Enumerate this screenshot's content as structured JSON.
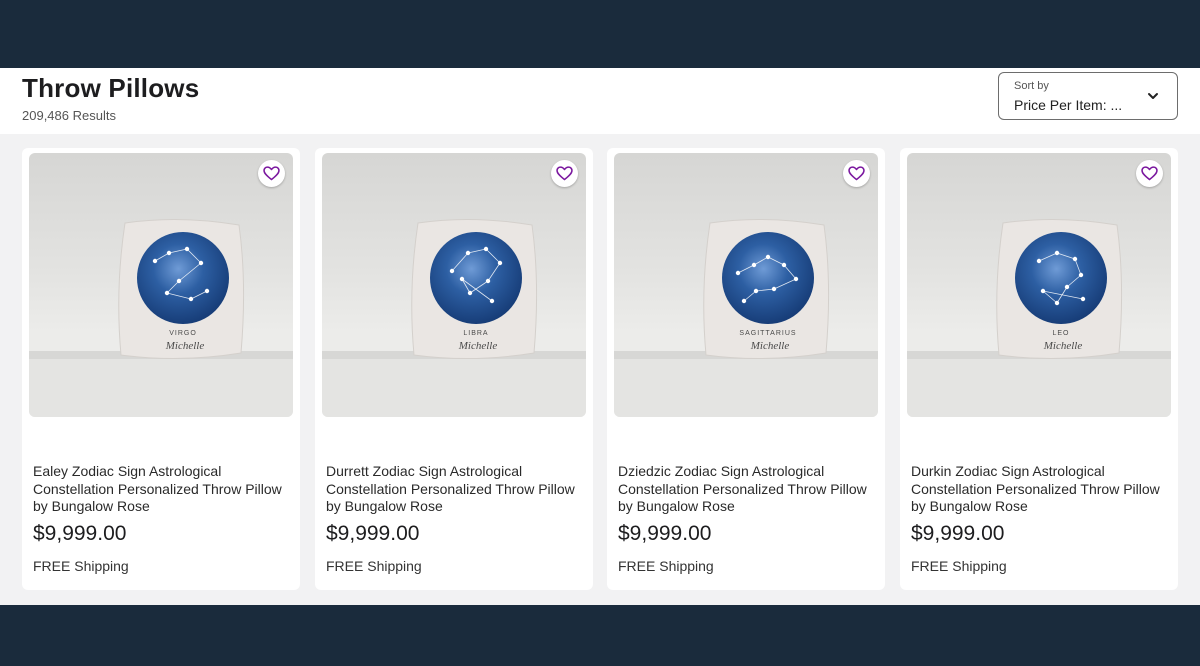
{
  "header": {
    "title": "Throw Pillows",
    "results": "209,486 Results"
  },
  "sort": {
    "label": "Sort by",
    "value": "Price Per Item: ..."
  },
  "products": [
    {
      "name": "Ealey Zodiac Sign Astrological Constellation Personalized Throw Pillow",
      "by": "by Bungalow Rose",
      "price": "$9,999.00",
      "shipping": "FREE Shipping",
      "sign": "VIRGO",
      "script_name": "Michelle"
    },
    {
      "name": "Durrett Zodiac Sign Astrological Constellation Personalized Throw Pillow",
      "by": "by Bungalow Rose",
      "price": "$9,999.00",
      "shipping": "FREE Shipping",
      "sign": "LIBRA",
      "script_name": "Michelle"
    },
    {
      "name": "Dziedzic Zodiac Sign Astrological Constellation Personalized Throw Pillow",
      "by": "by Bungalow Rose",
      "price": "$9,999.00",
      "shipping": "FREE Shipping",
      "sign": "SAGITTARIUS",
      "script_name": "Michelle"
    },
    {
      "name": "Durkin Zodiac Sign Astrological Constellation Personalized Throw Pillow",
      "by": "by Bungalow Rose",
      "price": "$9,999.00",
      "shipping": "FREE Shipping",
      "sign": "LEO",
      "script_name": "Michelle"
    }
  ],
  "icons": {
    "favorite": "heart-icon",
    "sort": "chevron-down-icon"
  },
  "colors": {
    "top_bar": "#1a2b3c",
    "heart": "#7b189f",
    "watercolor": "#2d5fa3"
  }
}
